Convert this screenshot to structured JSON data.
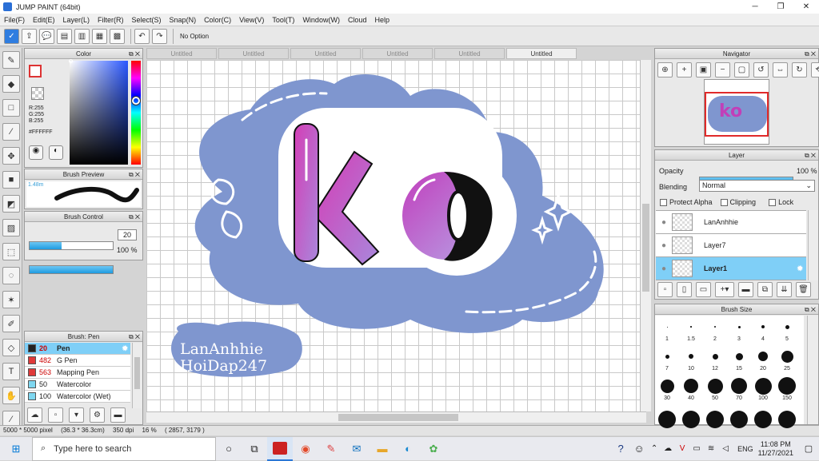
{
  "window": {
    "title": "JUMP PAINT (64bit)",
    "minimize": "─",
    "maximize": "❐",
    "close": "✕"
  },
  "menu": [
    "File(F)",
    "Edit(E)",
    "Layer(L)",
    "Filter(R)",
    "Select(S)",
    "Snap(N)",
    "Color(C)",
    "View(V)",
    "Tool(T)",
    "Window(W)",
    "Cloud",
    "Help"
  ],
  "toolbar": {
    "option_label": "No Option"
  },
  "color_panel": {
    "title": "Color",
    "r": "R:255",
    "g": "G:255",
    "b": "B:255",
    "hex": "#FFFFFF"
  },
  "brush_preview": {
    "title": "Brush Preview",
    "size": "1.48m"
  },
  "brush_control": {
    "title": "Brush Control",
    "size_value": "20",
    "opacity_value": "100 %",
    "size_fraction": 0.38,
    "opacity_fraction": 1.0
  },
  "brush_list": {
    "title": "Brush: Pen",
    "items": [
      {
        "num": "20",
        "name": "Pen",
        "color": "#222222",
        "selected": true
      },
      {
        "num": "482",
        "name": "G Pen",
        "color": "#e03a3a"
      },
      {
        "num": "563",
        "name": "Mapping Pen",
        "color": "#e03a3a"
      },
      {
        "num": "50",
        "name": "Watercolor",
        "color": "#7fd7f0"
      },
      {
        "num": "100",
        "name": "Watercolor (Wet)",
        "color": "#7fd7f0"
      }
    ]
  },
  "tabs": [
    "Untitled",
    "Untitled",
    "Untitled",
    "Untitled",
    "Untitled",
    "Untitled"
  ],
  "artwork": {
    "main_text": "ko",
    "watermark_line1": "LanAnhhie",
    "watermark_line2": "HoiDap247",
    "bubble_color": "#7f96cf"
  },
  "status": {
    "size": "5000 * 5000 pixel",
    "cm": "(36.3 * 36.3cm)",
    "dpi": "350 dpi",
    "zoom": "16 %",
    "coords": "( 2857, 3179 )"
  },
  "navigator": {
    "title": "Navigator"
  },
  "layer_panel": {
    "title": "Layer",
    "opacity_label": "Opacity",
    "opacity_value": "100 %",
    "blending_label": "Blending",
    "blending_value": "Normal",
    "protect_alpha": "Protect Alpha",
    "clipping": "Clipping",
    "lock": "Lock",
    "layers": [
      {
        "name": "LanAnhhie",
        "selected": false
      },
      {
        "name": "Layer7",
        "selected": false
      },
      {
        "name": "Layer1",
        "selected": true
      }
    ]
  },
  "brush_size": {
    "title": "Brush Size",
    "labels": [
      "1",
      "1.5",
      "2",
      "3",
      "4",
      "5",
      "7",
      "10",
      "12",
      "15",
      "20",
      "25",
      "30",
      "40",
      "50",
      "70",
      "100",
      "150"
    ]
  },
  "taskbar": {
    "search_placeholder": "Type here to search",
    "lang": "ENG",
    "time": "11:08 PM",
    "date": "11/27/2021"
  }
}
